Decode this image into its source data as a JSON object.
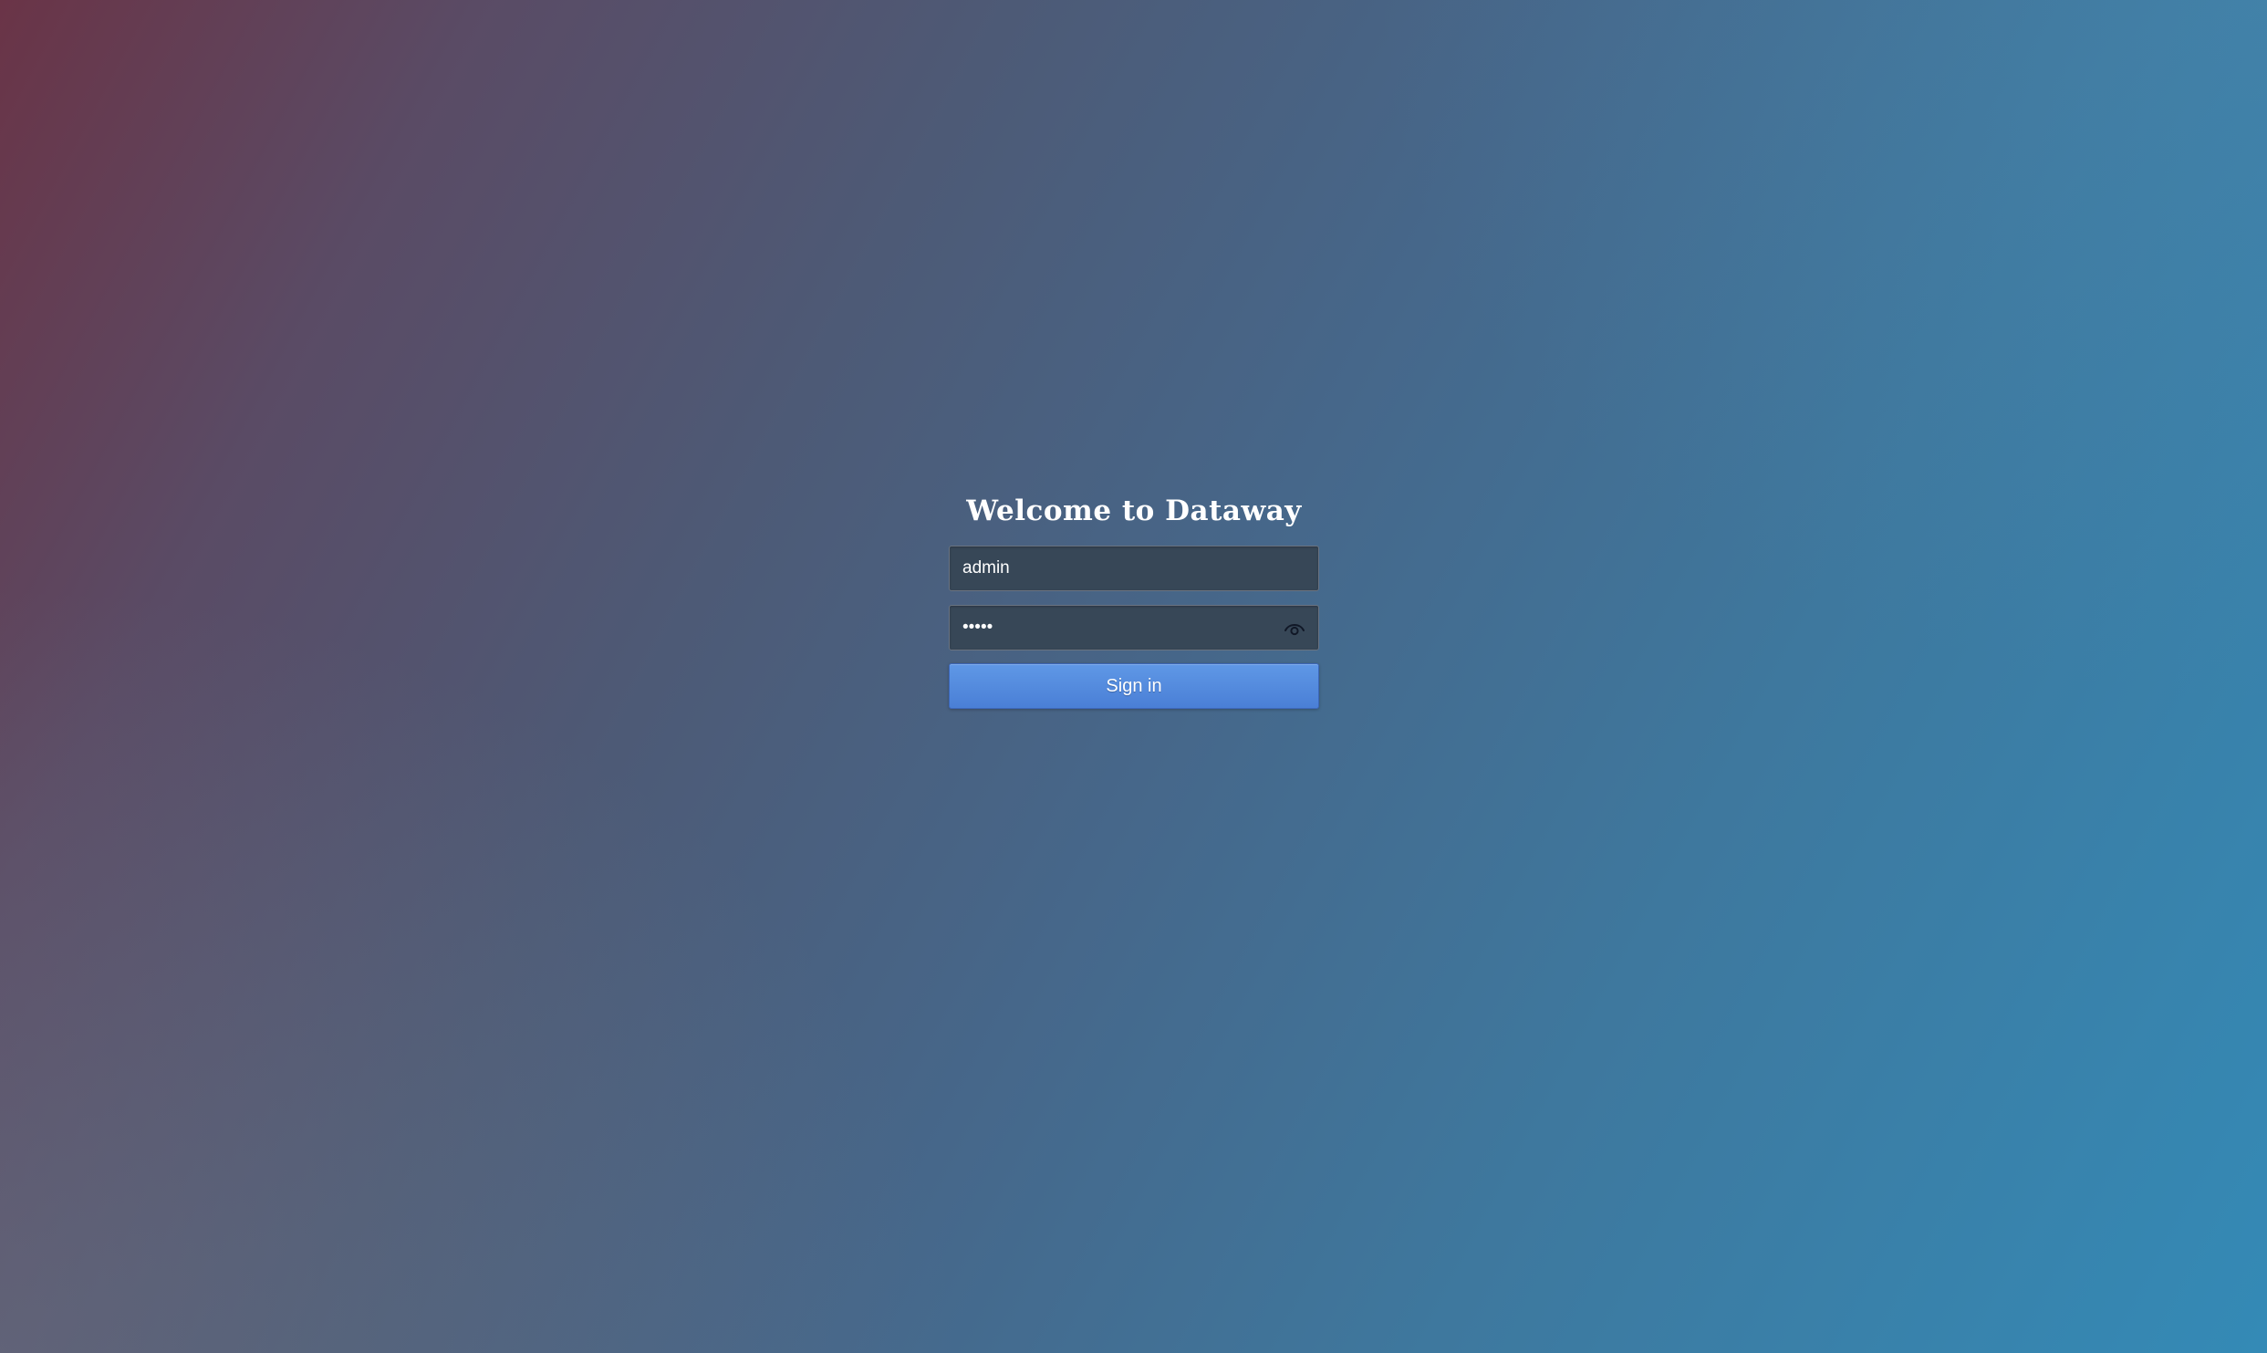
{
  "page": {
    "title": "Welcome to Dataway"
  },
  "login_form": {
    "username": {
      "value": "admin",
      "placeholder": ""
    },
    "password": {
      "value": "•••••",
      "placeholder": "",
      "visibility_icon": "eye-icon"
    },
    "submit_label": "Sign in"
  },
  "colors": {
    "background_top_left": "#6a3447",
    "background_bottom_right": "#348ab6",
    "input_background": "#374757",
    "button_primary": "#4f86da",
    "text": "#ffffff"
  }
}
